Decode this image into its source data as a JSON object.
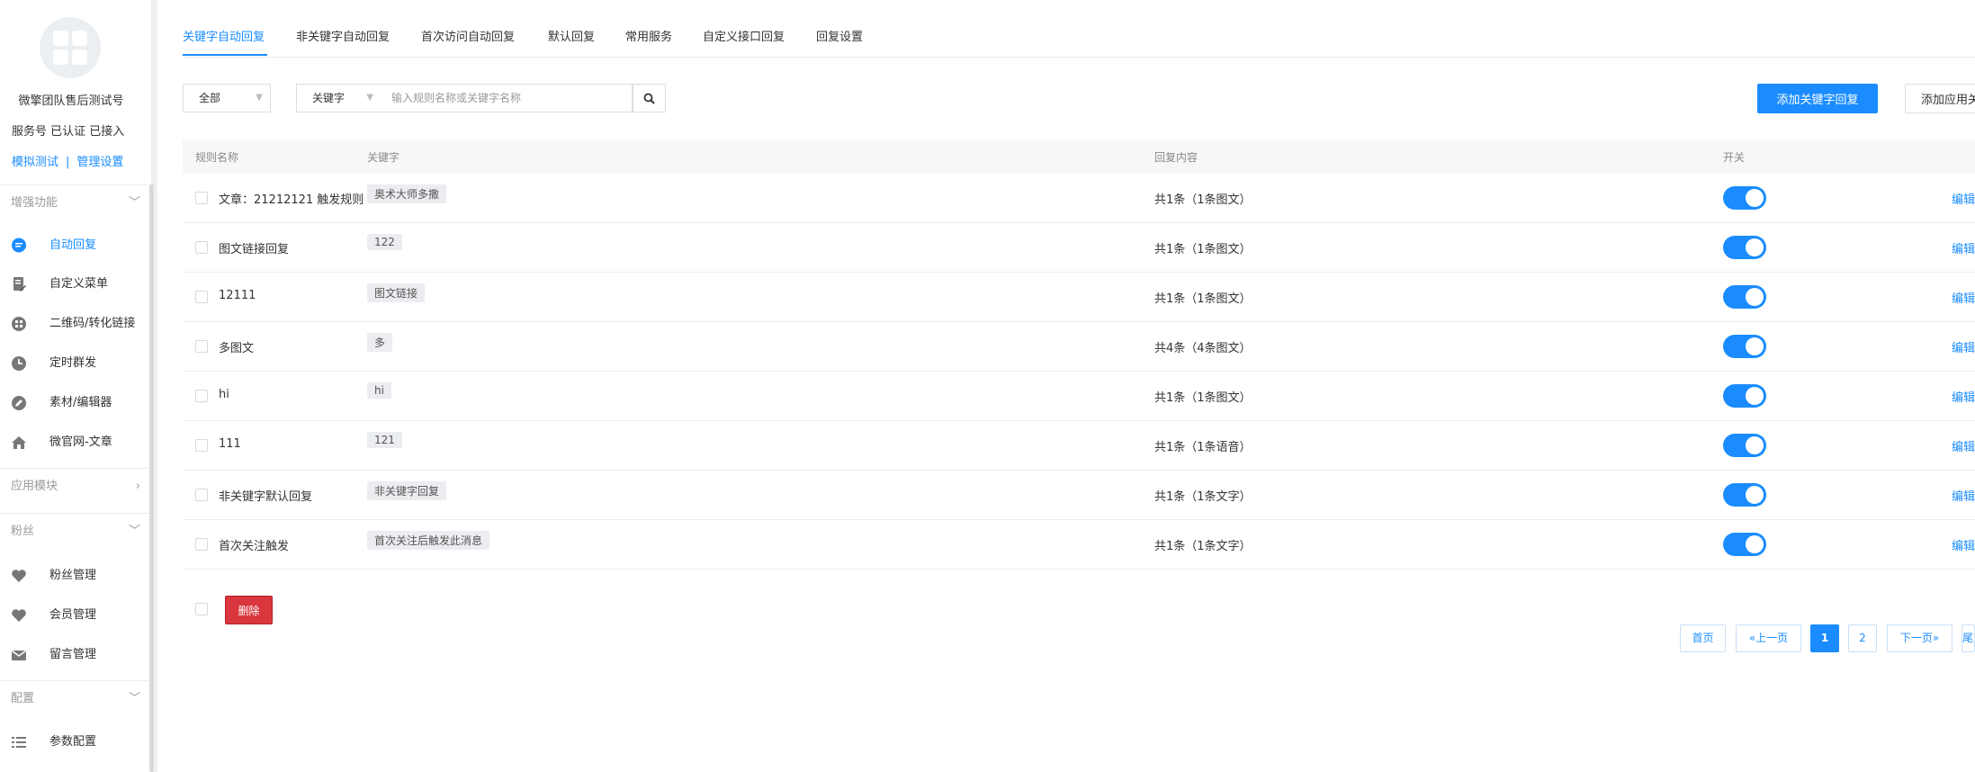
{
  "account": {
    "name": "微擎团队售后测试号",
    "status": "服务号 已认证 已接入",
    "links": [
      "模拟测试",
      "管理设置"
    ]
  },
  "sidebar": {
    "sections": [
      {
        "label": "增强功能",
        "chevron": "down"
      },
      {
        "label": "应用模块",
        "chevron": "right"
      },
      {
        "label": "粉丝",
        "chevron": "down"
      },
      {
        "label": "配置",
        "chevron": "down"
      }
    ],
    "chevrons": {
      "down": "﹀",
      "right": "›"
    },
    "items": [
      {
        "label": "自动回复",
        "icon": "chat-bubble-icon",
        "active": true
      },
      {
        "label": "自定义菜单",
        "icon": "document-edit-icon"
      },
      {
        "label": "二维码/转化链接",
        "icon": "qrcode-icon"
      },
      {
        "label": "定时群发",
        "icon": "clock-icon"
      },
      {
        "label": "素材/编辑器",
        "icon": "pencil-icon"
      },
      {
        "label": "微官网-文章",
        "icon": "home-icon"
      },
      {
        "label": "粉丝管理",
        "icon": "heart-icon"
      },
      {
        "label": "会员管理",
        "icon": "heart-icon"
      },
      {
        "label": "留言管理",
        "icon": "envelope-icon"
      },
      {
        "label": "参数配置",
        "icon": "list-icon"
      }
    ]
  },
  "tabs": [
    "关键字自动回复",
    "非关键字自动回复",
    "首次访问自动回复",
    "默认回复",
    "常用服务",
    "自定义接口回复",
    "回复设置"
  ],
  "filters": {
    "scope": "全部",
    "type": "关键字",
    "search_placeholder": "输入规则名称或关键字名称"
  },
  "actions": {
    "add_keyword": "添加关键字回复",
    "add_app": "添加应用关键字"
  },
  "table": {
    "columns": [
      "规则名称",
      "关键字",
      "回复内容",
      "开关"
    ],
    "edit_label": "编辑",
    "rows": [
      {
        "name": "文章：21212121 触发规则",
        "keyword": "奥术大师多撒",
        "reply": "共1条（1条图文）",
        "enabled": true
      },
      {
        "name": "图文链接回复",
        "keyword": "122",
        "reply": "共1条（1条图文）",
        "enabled": true
      },
      {
        "name": "12111",
        "keyword": "图文链接",
        "reply": "共1条（1条图文）",
        "enabled": true
      },
      {
        "name": "多图文",
        "keyword": "多",
        "reply": "共4条（4条图文）",
        "enabled": true
      },
      {
        "name": "hi",
        "keyword": "hi",
        "reply": "共1条（1条图文）",
        "enabled": true
      },
      {
        "name": "111",
        "keyword": "121",
        "reply": "共1条（1条语音）",
        "enabled": true
      },
      {
        "name": "非关键字默认回复",
        "keyword": "非关键字回复",
        "reply": "共1条（1条文字）",
        "enabled": true
      },
      {
        "name": "首次关注触发",
        "keyword": "首次关注后触发此消息",
        "reply": "共1条（1条文字）",
        "enabled": true
      }
    ]
  },
  "bulk": {
    "delete_label": "删除"
  },
  "pagination": {
    "first": "首页",
    "prev": "«上一页",
    "pages": [
      "1",
      "2"
    ],
    "current": "1",
    "next": "下一页»",
    "last": "尾页"
  },
  "colors": {
    "accent": "#1a8cff",
    "danger": "#d9363e"
  }
}
